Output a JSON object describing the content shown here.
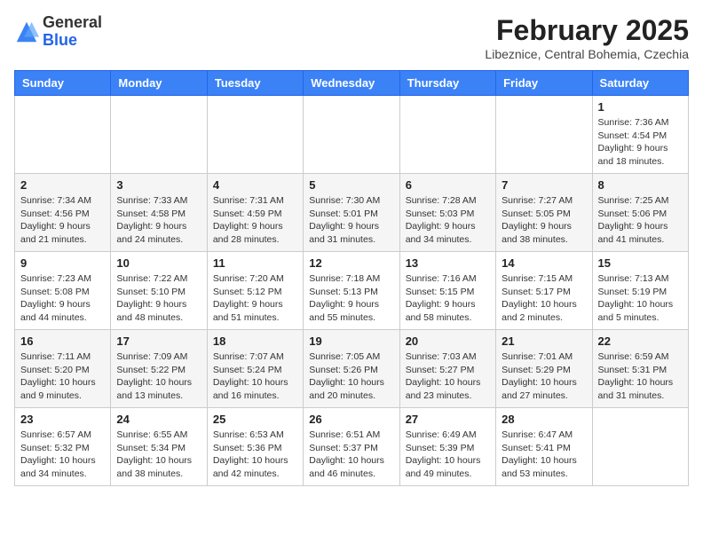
{
  "logo": {
    "general": "General",
    "blue": "Blue"
  },
  "header": {
    "month_title": "February 2025",
    "subtitle": "Libeznice, Central Bohemia, Czechia"
  },
  "days_of_week": [
    "Sunday",
    "Monday",
    "Tuesday",
    "Wednesday",
    "Thursday",
    "Friday",
    "Saturday"
  ],
  "weeks": [
    [
      {
        "day": "",
        "info": ""
      },
      {
        "day": "",
        "info": ""
      },
      {
        "day": "",
        "info": ""
      },
      {
        "day": "",
        "info": ""
      },
      {
        "day": "",
        "info": ""
      },
      {
        "day": "",
        "info": ""
      },
      {
        "day": "1",
        "info": "Sunrise: 7:36 AM\nSunset: 4:54 PM\nDaylight: 9 hours and 18 minutes."
      }
    ],
    [
      {
        "day": "2",
        "info": "Sunrise: 7:34 AM\nSunset: 4:56 PM\nDaylight: 9 hours and 21 minutes."
      },
      {
        "day": "3",
        "info": "Sunrise: 7:33 AM\nSunset: 4:58 PM\nDaylight: 9 hours and 24 minutes."
      },
      {
        "day": "4",
        "info": "Sunrise: 7:31 AM\nSunset: 4:59 PM\nDaylight: 9 hours and 28 minutes."
      },
      {
        "day": "5",
        "info": "Sunrise: 7:30 AM\nSunset: 5:01 PM\nDaylight: 9 hours and 31 minutes."
      },
      {
        "day": "6",
        "info": "Sunrise: 7:28 AM\nSunset: 5:03 PM\nDaylight: 9 hours and 34 minutes."
      },
      {
        "day": "7",
        "info": "Sunrise: 7:27 AM\nSunset: 5:05 PM\nDaylight: 9 hours and 38 minutes."
      },
      {
        "day": "8",
        "info": "Sunrise: 7:25 AM\nSunset: 5:06 PM\nDaylight: 9 hours and 41 minutes."
      }
    ],
    [
      {
        "day": "9",
        "info": "Sunrise: 7:23 AM\nSunset: 5:08 PM\nDaylight: 9 hours and 44 minutes."
      },
      {
        "day": "10",
        "info": "Sunrise: 7:22 AM\nSunset: 5:10 PM\nDaylight: 9 hours and 48 minutes."
      },
      {
        "day": "11",
        "info": "Sunrise: 7:20 AM\nSunset: 5:12 PM\nDaylight: 9 hours and 51 minutes."
      },
      {
        "day": "12",
        "info": "Sunrise: 7:18 AM\nSunset: 5:13 PM\nDaylight: 9 hours and 55 minutes."
      },
      {
        "day": "13",
        "info": "Sunrise: 7:16 AM\nSunset: 5:15 PM\nDaylight: 9 hours and 58 minutes."
      },
      {
        "day": "14",
        "info": "Sunrise: 7:15 AM\nSunset: 5:17 PM\nDaylight: 10 hours and 2 minutes."
      },
      {
        "day": "15",
        "info": "Sunrise: 7:13 AM\nSunset: 5:19 PM\nDaylight: 10 hours and 5 minutes."
      }
    ],
    [
      {
        "day": "16",
        "info": "Sunrise: 7:11 AM\nSunset: 5:20 PM\nDaylight: 10 hours and 9 minutes."
      },
      {
        "day": "17",
        "info": "Sunrise: 7:09 AM\nSunset: 5:22 PM\nDaylight: 10 hours and 13 minutes."
      },
      {
        "day": "18",
        "info": "Sunrise: 7:07 AM\nSunset: 5:24 PM\nDaylight: 10 hours and 16 minutes."
      },
      {
        "day": "19",
        "info": "Sunrise: 7:05 AM\nSunset: 5:26 PM\nDaylight: 10 hours and 20 minutes."
      },
      {
        "day": "20",
        "info": "Sunrise: 7:03 AM\nSunset: 5:27 PM\nDaylight: 10 hours and 23 minutes."
      },
      {
        "day": "21",
        "info": "Sunrise: 7:01 AM\nSunset: 5:29 PM\nDaylight: 10 hours and 27 minutes."
      },
      {
        "day": "22",
        "info": "Sunrise: 6:59 AM\nSunset: 5:31 PM\nDaylight: 10 hours and 31 minutes."
      }
    ],
    [
      {
        "day": "23",
        "info": "Sunrise: 6:57 AM\nSunset: 5:32 PM\nDaylight: 10 hours and 34 minutes."
      },
      {
        "day": "24",
        "info": "Sunrise: 6:55 AM\nSunset: 5:34 PM\nDaylight: 10 hours and 38 minutes."
      },
      {
        "day": "25",
        "info": "Sunrise: 6:53 AM\nSunset: 5:36 PM\nDaylight: 10 hours and 42 minutes."
      },
      {
        "day": "26",
        "info": "Sunrise: 6:51 AM\nSunset: 5:37 PM\nDaylight: 10 hours and 46 minutes."
      },
      {
        "day": "27",
        "info": "Sunrise: 6:49 AM\nSunset: 5:39 PM\nDaylight: 10 hours and 49 minutes."
      },
      {
        "day": "28",
        "info": "Sunrise: 6:47 AM\nSunset: 5:41 PM\nDaylight: 10 hours and 53 minutes."
      },
      {
        "day": "",
        "info": ""
      }
    ]
  ]
}
